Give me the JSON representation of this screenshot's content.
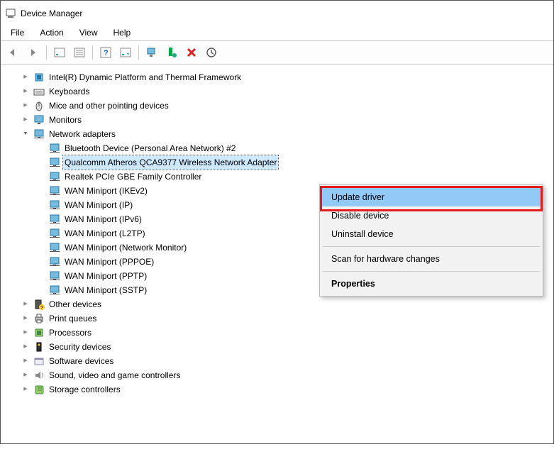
{
  "window": {
    "title": "Device Manager"
  },
  "menu": {
    "file": "File",
    "action": "Action",
    "view": "View",
    "help": "Help"
  },
  "toolbar": {
    "back": "back",
    "forward": "forward",
    "show": "show-list",
    "props": "properties",
    "help": "help",
    "update": "update",
    "monitor": "monitor",
    "install": "install",
    "remove": "remove",
    "scan": "scan"
  },
  "tree": {
    "items": [
      {
        "depth": 0,
        "exp": "closed",
        "icon": "chip",
        "label": "Intel(R) Dynamic Platform and Thermal Framework"
      },
      {
        "depth": 0,
        "exp": "closed",
        "icon": "keyboard",
        "label": "Keyboards"
      },
      {
        "depth": 0,
        "exp": "closed",
        "icon": "mouse",
        "label": "Mice and other pointing devices"
      },
      {
        "depth": 0,
        "exp": "closed",
        "icon": "monitor",
        "label": "Monitors"
      },
      {
        "depth": 0,
        "exp": "open",
        "icon": "network",
        "label": "Network adapters"
      },
      {
        "depth": 1,
        "exp": "none",
        "icon": "network",
        "label": "Bluetooth Device (Personal Area Network) #2"
      },
      {
        "depth": 1,
        "exp": "none",
        "icon": "network",
        "label": "Qualcomm Atheros QCA9377 Wireless Network Adapter",
        "selected": true
      },
      {
        "depth": 1,
        "exp": "none",
        "icon": "network",
        "label": "Realtek PCIe GBE Family Controller"
      },
      {
        "depth": 1,
        "exp": "none",
        "icon": "network",
        "label": "WAN Miniport (IKEv2)"
      },
      {
        "depth": 1,
        "exp": "none",
        "icon": "network",
        "label": "WAN Miniport (IP)"
      },
      {
        "depth": 1,
        "exp": "none",
        "icon": "network",
        "label": "WAN Miniport (IPv6)"
      },
      {
        "depth": 1,
        "exp": "none",
        "icon": "network",
        "label": "WAN Miniport (L2TP)"
      },
      {
        "depth": 1,
        "exp": "none",
        "icon": "network",
        "label": "WAN Miniport (Network Monitor)"
      },
      {
        "depth": 1,
        "exp": "none",
        "icon": "network",
        "label": "WAN Miniport (PPPOE)"
      },
      {
        "depth": 1,
        "exp": "none",
        "icon": "network",
        "label": "WAN Miniport (PPTP)"
      },
      {
        "depth": 1,
        "exp": "none",
        "icon": "network",
        "label": "WAN Miniport (SSTP)"
      },
      {
        "depth": 0,
        "exp": "closed",
        "icon": "unknown",
        "label": "Other devices"
      },
      {
        "depth": 0,
        "exp": "closed",
        "icon": "printer",
        "label": "Print queues"
      },
      {
        "depth": 0,
        "exp": "closed",
        "icon": "cpu",
        "label": "Processors"
      },
      {
        "depth": 0,
        "exp": "closed",
        "icon": "security",
        "label": "Security devices"
      },
      {
        "depth": 0,
        "exp": "closed",
        "icon": "software",
        "label": "Software devices"
      },
      {
        "depth": 0,
        "exp": "closed",
        "icon": "audio",
        "label": "Sound, video and game controllers"
      },
      {
        "depth": 0,
        "exp": "closed",
        "icon": "storage",
        "label": "Storage controllers"
      }
    ]
  },
  "contextMenu": {
    "update": "Update driver",
    "disable": "Disable device",
    "uninstall": "Uninstall device",
    "scan": "Scan for hardware changes",
    "properties": "Properties"
  }
}
